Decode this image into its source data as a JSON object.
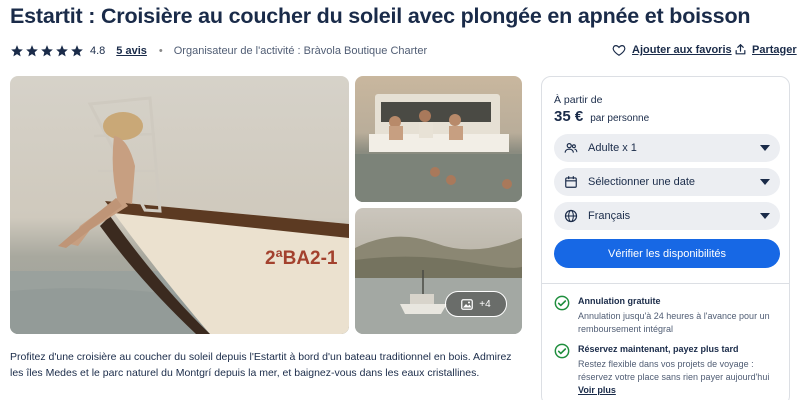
{
  "header": {
    "title": "Estartit : Croisière au coucher du soleil avec plongée en apnée et boisson",
    "rating": "4.8",
    "reviews": "5 avis",
    "organizer": "Organisateur de l'activité : Bràvola Boutique Charter",
    "favorite_label": "Ajouter aux favoris",
    "share_label": "Partager"
  },
  "gallery": {
    "boat_number": "2ªBA2-1",
    "more_count": "+4"
  },
  "description": "Profitez d'une croisière au coucher du soleil depuis l'Estartit à bord d'un bateau traditionnel en bois. Admirez les îles Medes et le parc naturel du Montgrí depuis la mer, et baignez-vous dans les eaux cristallines.",
  "booking": {
    "from_label": "À partir de",
    "price": "35 €",
    "price_unit": "par personne",
    "participants": "Adulte x 1",
    "date": "Sélectionner une date",
    "language": "Français",
    "cta": "Vérifier les disponibilités"
  },
  "features": [
    {
      "title": "Annulation gratuite",
      "text": "Annulation jusqu'à 24 heures à l'avance pour un remboursement intégral"
    },
    {
      "title": "Réservez maintenant, payez plus tard",
      "text": "Restez flexible dans vos projets de voyage : réservez votre place sans rien payer aujourd'hui",
      "link": "Voir plus"
    }
  ],
  "colors": {
    "primary": "#1768e5",
    "text": "#1a2b49",
    "check": "#1f8e3d"
  }
}
